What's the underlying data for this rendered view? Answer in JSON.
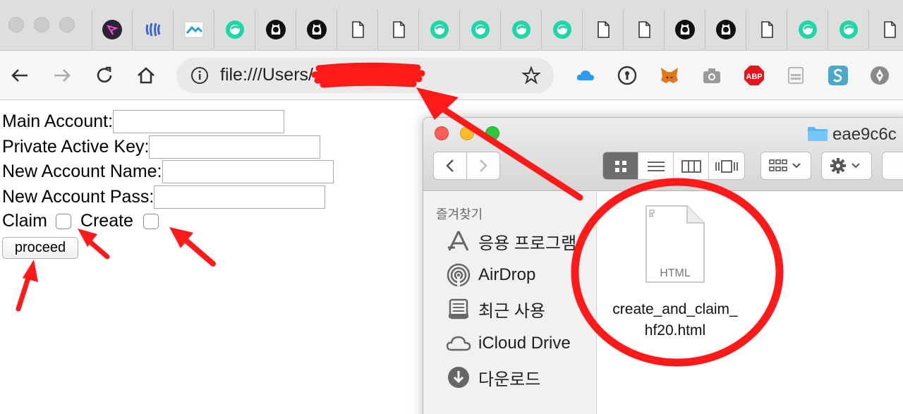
{
  "browser": {
    "tab_icons": [
      "tab-icon-purple-arrow",
      "tab-icon-steem",
      "tab-icon-cloud",
      "tab-icon-steemit",
      "tab-icon-github",
      "tab-icon-github",
      "tab-icon-document",
      "tab-icon-document",
      "tab-icon-steemit",
      "tab-icon-steemit",
      "tab-icon-steemit",
      "tab-icon-steemit",
      "tab-icon-document",
      "tab-icon-document",
      "tab-icon-github",
      "tab-icon-github",
      "tab-icon-document",
      "tab-icon-steemit",
      "tab-icon-steemit",
      "tab-icon-document"
    ],
    "address_url": "file:///Users/                /Downl...",
    "extension_icons": [
      "icloud-icon",
      "keyhole-icon",
      "metamask-fox-icon",
      "camera-icon",
      "abp-icon",
      "drive-icon",
      "steem-s-icon",
      "pen-nib-icon"
    ],
    "abp_label": "ABP"
  },
  "form": {
    "main_account_label": "Main Account:",
    "private_active_key_label": "Private Active Key:",
    "new_account_name_label": "New Account Name:",
    "new_account_pass_label": "New Account Pass:",
    "claim_label": "Claim",
    "create_label": "Create",
    "proceed_label": "proceed"
  },
  "finder": {
    "title": "eae9c6c",
    "sidebar_heading": "즐겨찾기",
    "sidebar_items": [
      {
        "label": "응용 프로그램",
        "icon": "applications-icon"
      },
      {
        "label": "AirDrop",
        "icon": "airdrop-icon"
      },
      {
        "label": "최근 사용",
        "icon": "recents-icon"
      },
      {
        "label": "iCloud Drive",
        "icon": "icloud-drive-icon"
      },
      {
        "label": "다운로드",
        "icon": "downloads-icon"
      }
    ],
    "file": {
      "type_label": "HTML",
      "name_line1": "create_and_claim_",
      "name_line2": "hf20.html"
    }
  },
  "colors": {
    "annotation_red": "#ff1a1a",
    "steemit_green": "#1fd6a6",
    "finder_active_view": "#6d6d6d"
  }
}
